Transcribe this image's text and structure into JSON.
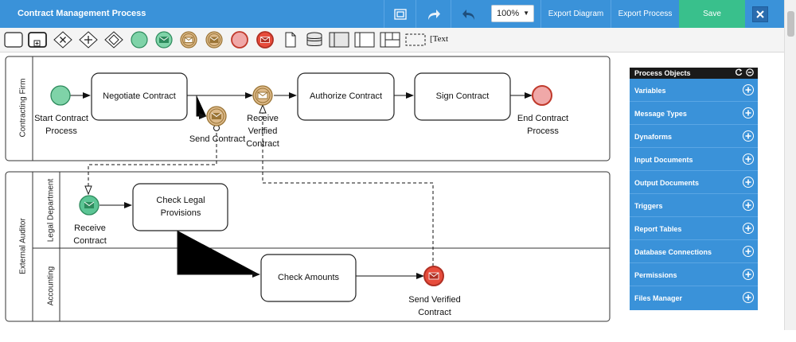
{
  "header": {
    "title": "Contract Management Process",
    "zoom_value": "100%",
    "export_diagram": "Export Diagram",
    "export_process": "Export Process",
    "save": "Save"
  },
  "toolbar": {
    "text_tool": "Text"
  },
  "lanes": {
    "pool1": "Contracting Firm",
    "pool2": "External Auditor",
    "lane_legal": "Legal Department",
    "lane_accounting": "Accounting"
  },
  "nodes": {
    "start": "Start Contract Process",
    "negotiate": "Negotiate Contract",
    "send_contract": "Send Contract",
    "receive_verified": "Receive Verified Contract",
    "authorize": "Authorize Contract",
    "sign": "Sign Contract",
    "end": "End Contract Process",
    "receive_contract": "Receive Contract",
    "check_legal": "Check Legal Provisions",
    "check_amounts": "Check Amounts",
    "send_verified": "Send Verified Contract"
  },
  "panel": {
    "title": "Process Objects",
    "items": [
      "Variables",
      "Message Types",
      "Dynaforms",
      "Input Documents",
      "Output Documents",
      "Triggers",
      "Report Tables",
      "Database Connections",
      "Permissions",
      "Files Manager"
    ]
  },
  "colors": {
    "header_blue": "#3a92d9",
    "save_green": "#39c08c",
    "start_green": "#7fd3a8",
    "end_red": "#f0a8a8",
    "message_tan": "#c8a062"
  }
}
